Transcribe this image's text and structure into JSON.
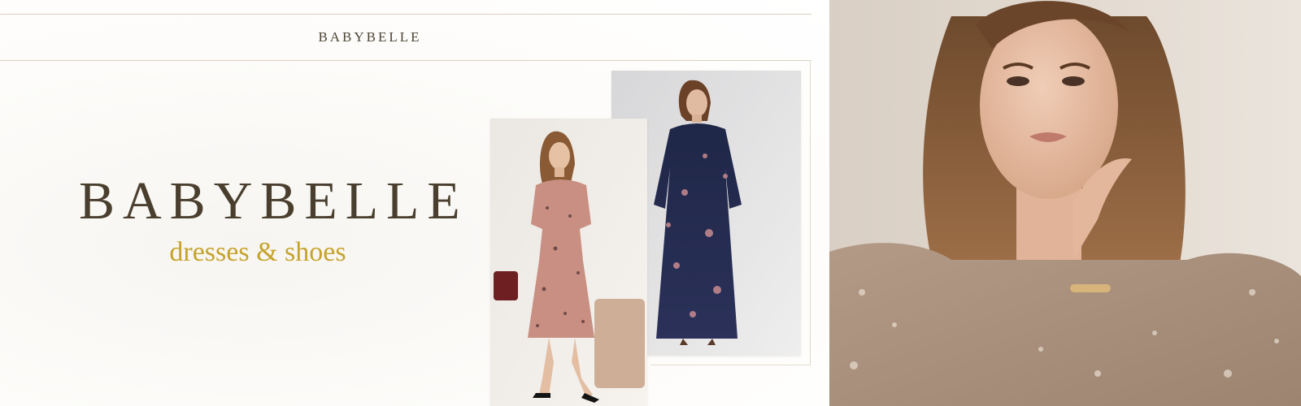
{
  "header": {
    "brand": "BABYBELLE"
  },
  "hero": {
    "title": "BABYBELLE",
    "subtitle": "dresses & shoes"
  },
  "colors": {
    "brand_text": "#4a3f2e",
    "accent_gold": "#c6a32c",
    "rule": "#d9d0bf"
  },
  "images": {
    "front_card": "model-pink-floral-dress-photo",
    "back_card": "model-navy-floral-maxi-dress-photo",
    "portrait": "model-portrait-photo"
  }
}
